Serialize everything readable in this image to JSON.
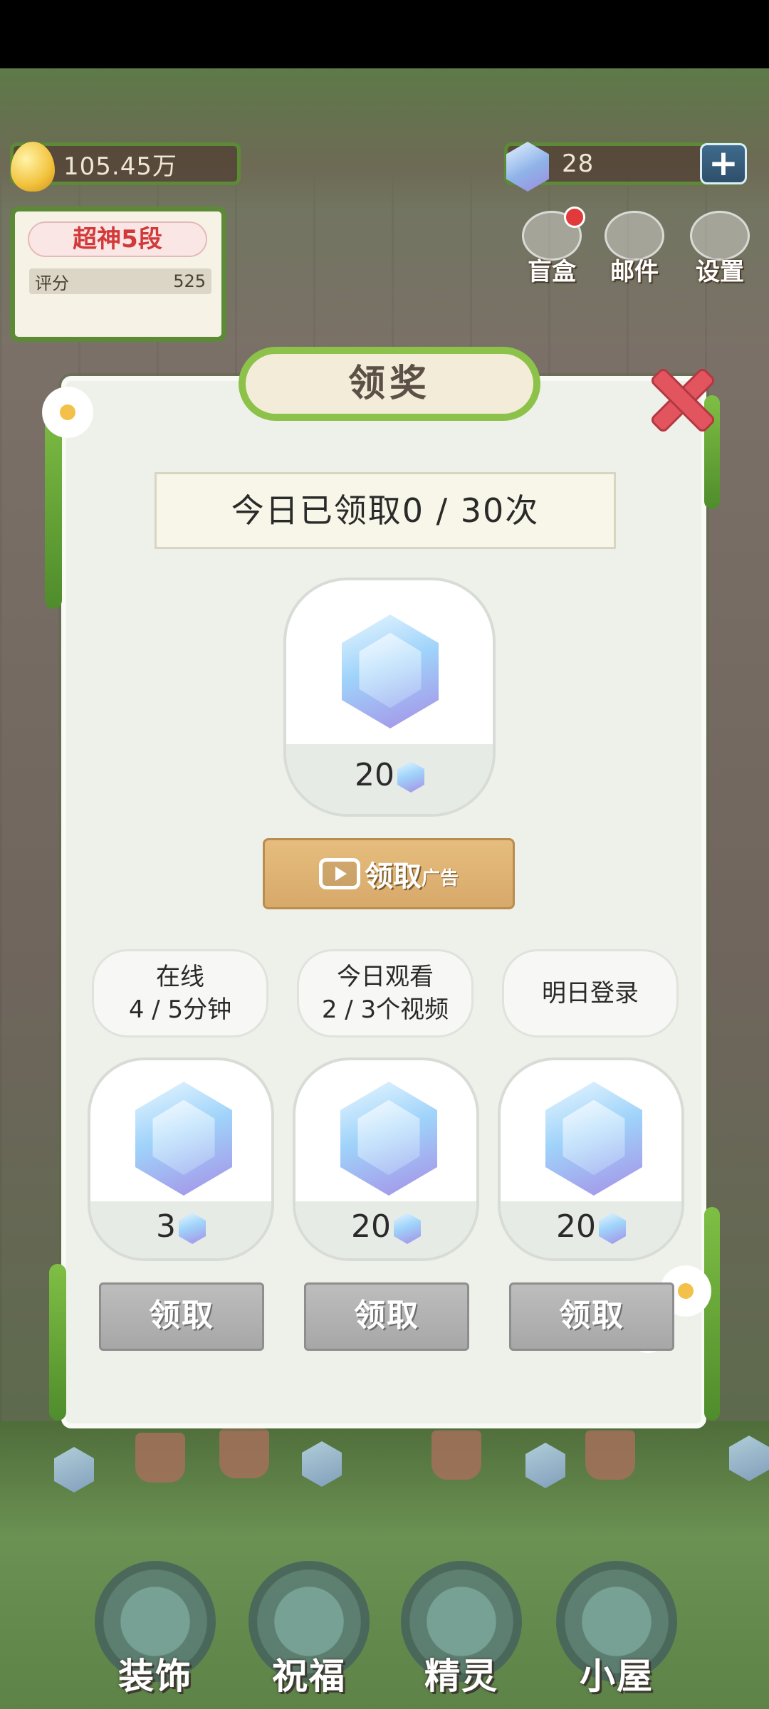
{
  "top_bar": {
    "gold_value": "105.45万",
    "gem_value": "28",
    "add_label": "+"
  },
  "rank": {
    "title": "超神5段",
    "score_label": "评分",
    "score_value": "525"
  },
  "top_menu": {
    "blind_box": "盲盒",
    "mail": "邮件",
    "settings": "设置"
  },
  "dialog": {
    "title": "领奖",
    "claimed_today": "今日已领取0 / 30次",
    "main_reward_count": "20",
    "ad_button_label": "领取",
    "ad_tag": "广告",
    "tasks": [
      {
        "line1": "在线",
        "line2": "4 / 5分钟",
        "reward": "3",
        "button": "领取"
      },
      {
        "line1": "今日观看",
        "line2": "2 / 3个视频",
        "reward": "20",
        "button": "领取"
      },
      {
        "line1": "明日登录",
        "line2": "",
        "reward": "20",
        "button": "领取"
      }
    ]
  },
  "bottom_nav": {
    "decor": "装饰",
    "blessing": "祝福",
    "spirit": "精灵",
    "house": "小屋"
  }
}
